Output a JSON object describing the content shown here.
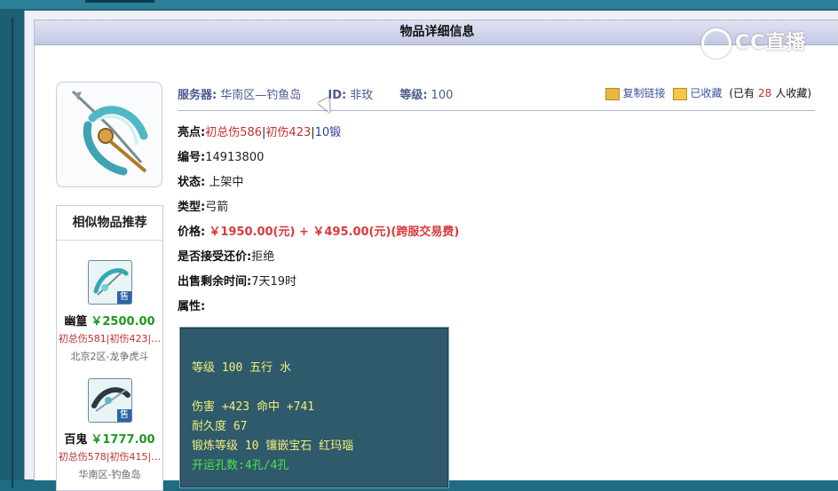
{
  "panel": {
    "title": "物品详细信息"
  },
  "watermark": "CC直播",
  "header": {
    "server_label": "服务器:",
    "server_value": "华南区—钓鱼岛",
    "id_label": "ID:",
    "id_value": "非玫",
    "level_label": "等级:",
    "level_value": "100",
    "copy_link": "复制链接",
    "favorited": "已收藏",
    "fav_prefix": "(已有",
    "fav_count": "28",
    "fav_suffix": "人收藏)"
  },
  "details": {
    "highlight_label": "亮点:",
    "highlight_1": "初总伤586",
    "highlight_2": "初伤423",
    "highlight_3": "10锻",
    "sep": "|",
    "number_label": "编号:",
    "number_value": "14913800",
    "status_label": "状态:",
    "status_value": "上架中",
    "type_label": "类型:",
    "type_value": "弓箭",
    "price_label": "价格:",
    "price_value": "￥1950.00(元) + ￥495.00(元)(跨服交易费)",
    "bargain_label": "是否接受还价:",
    "bargain_value": "拒绝",
    "remaining_label": "出售剩余时间:",
    "remaining_value": "7天19时",
    "attributes_label": "属性:"
  },
  "attributes": {
    "line1": "等级 100 五行 水",
    "line2": "伤害 +423 命中 +741",
    "line3": "耐久度 67",
    "line4": "锻炼等级 10 镶嵌宝石 红玛瑙",
    "line5": "开运孔数:4孔/4孔"
  },
  "similar": {
    "title": "相似物品推荐",
    "sold_badge": "售",
    "items": [
      {
        "name": "幽篁",
        "price": "￥2500.00",
        "tags": "初总伤581|初伤423|…",
        "server": "北京2区-龙争虎斗"
      },
      {
        "name": "百鬼",
        "price": "￥1777.00",
        "tags": "初总伤578|初伤415|…",
        "server": "华南区-钓鱼岛"
      }
    ]
  }
}
